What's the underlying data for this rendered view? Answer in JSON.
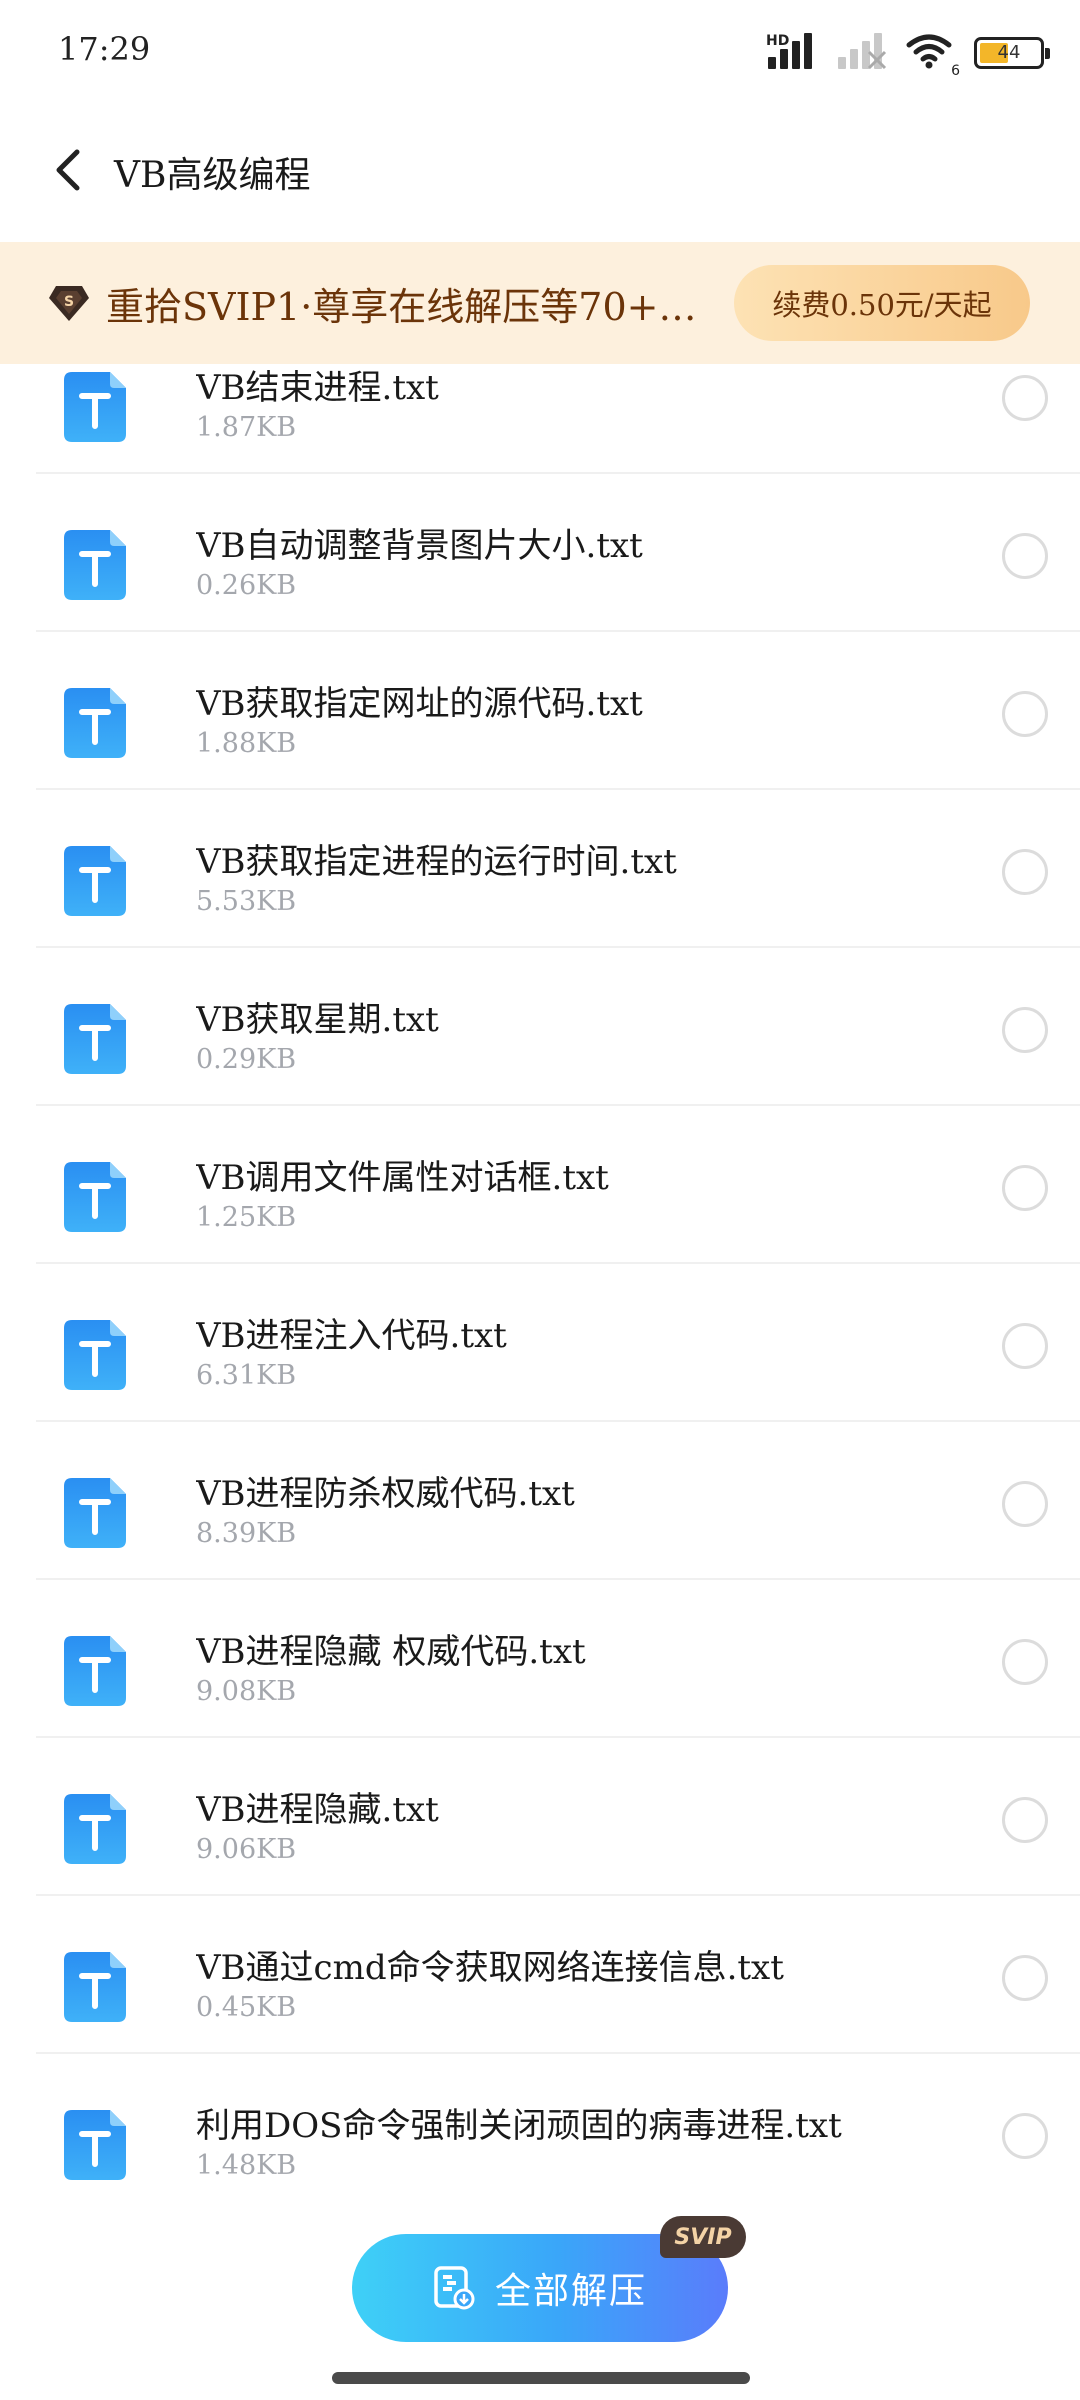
{
  "status_bar": {
    "time": "17:29",
    "network_label": "HD",
    "wifi_label": "6",
    "battery_level": "44",
    "battery_color": "#f3b629"
  },
  "header": {
    "back_icon": "chevron-left-icon",
    "title": "VB高级编程"
  },
  "banner": {
    "icon": "svip-diamond-icon",
    "text": "重拾SVIP1·尊享在线解压等70+…",
    "button_label": "续费0.50元/天起",
    "background_color": "#fdf0dd",
    "text_color": "#6b3409"
  },
  "files": [
    {
      "name": "VB结束进程.txt",
      "size": "1.87KB"
    },
    {
      "name": "VB自动调整背景图片大小.txt",
      "size": "0.26KB"
    },
    {
      "name": "VB获取指定网址的源代码.txt",
      "size": "1.88KB"
    },
    {
      "name": "VB获取指定进程的运行时间.txt",
      "size": "5.53KB"
    },
    {
      "name": "VB获取星期.txt",
      "size": "0.29KB"
    },
    {
      "name": "VB调用文件属性对话框.txt",
      "size": "1.25KB"
    },
    {
      "name": "VB进程注入代码.txt",
      "size": "6.31KB"
    },
    {
      "name": "VB进程防杀权威代码.txt",
      "size": "8.39KB"
    },
    {
      "name": "VB进程隐藏 权威代码.txt",
      "size": "9.08KB"
    },
    {
      "name": "VB进程隐藏.txt",
      "size": "9.06KB"
    },
    {
      "name": "VB通过cmd命令获取网络连接信息.txt",
      "size": "0.45KB"
    },
    {
      "name": "利用DOS命令强制关闭顽固的病毒进程.txt",
      "size": "1.48KB"
    }
  ],
  "file_icon": "txt-file-icon",
  "file_icon_color": "#2b9bf4",
  "bottom": {
    "extract_all_label": "全部解压",
    "extract_icon": "archive-extract-icon",
    "badge_label": "SVIP"
  }
}
